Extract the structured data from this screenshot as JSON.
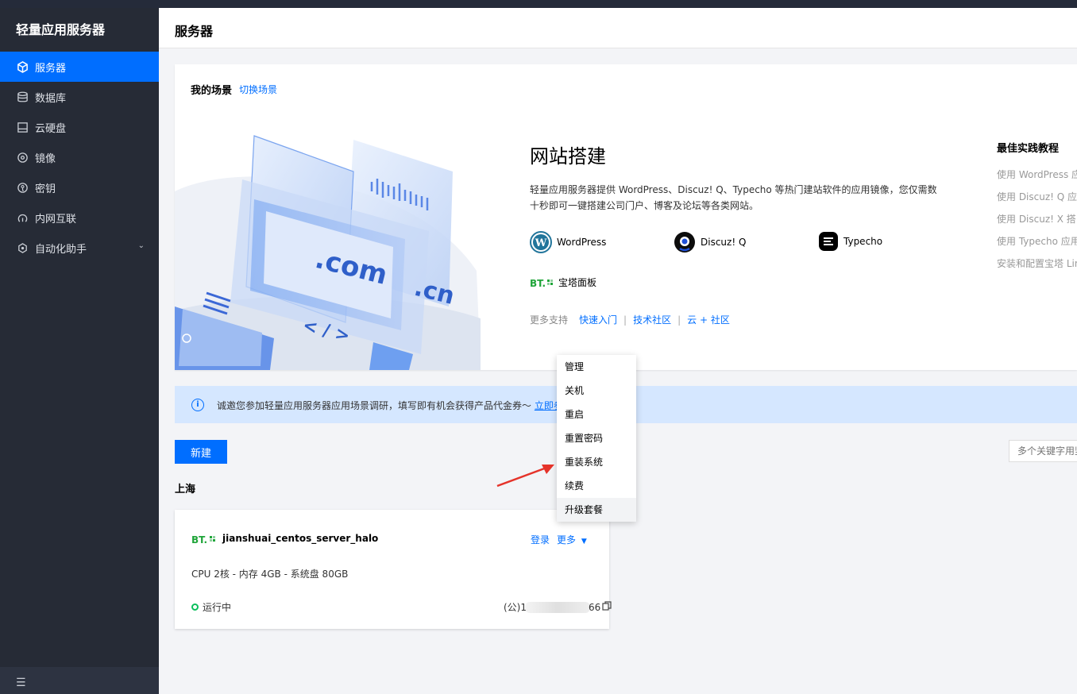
{
  "app": {
    "title": "轻量应用服务器"
  },
  "sidebar": {
    "items": [
      {
        "label": "服务器",
        "icon": "cube-icon"
      },
      {
        "label": "数据库",
        "icon": "database-icon"
      },
      {
        "label": "云硬盘",
        "icon": "disk-icon"
      },
      {
        "label": "镜像",
        "icon": "image-icon"
      },
      {
        "label": "密钥",
        "icon": "key-icon"
      },
      {
        "label": "内网互联",
        "icon": "network-icon"
      },
      {
        "label": "自动化助手",
        "icon": "robot-icon"
      }
    ]
  },
  "header": {
    "title": "服务器"
  },
  "scene": {
    "title": "我的场景",
    "switch": "切换场景",
    "heading": "网站搭建",
    "description": "轻量应用服务器提供 WordPress、Discuz! Q、Typecho 等热门建站软件的应用镜像，您仅需数十秒即可一键搭建公司门户、博客及论坛等各类网站。",
    "illustration": {
      "com": ".com",
      "cn": ".cn",
      "code": "< / >"
    },
    "apps": [
      {
        "label": "WordPress",
        "icon": "wordpress-icon"
      },
      {
        "label": "Discuz! Q",
        "icon": "discuz-icon"
      },
      {
        "label": "Typecho",
        "icon": "typecho-icon"
      },
      {
        "label": "宝塔面板",
        "icon": "bt-panel-icon"
      }
    ],
    "more": {
      "label": "更多支持",
      "links": [
        "快速入门",
        "技术社区",
        "云 + 社区"
      ]
    },
    "best": {
      "title": "最佳实践教程",
      "items": [
        "使用 WordPress 应",
        "使用 Discuz! Q 应用",
        "使用 Discuz! X 搭",
        "使用 Typecho 应用",
        "安装和配置宝塔 Lin"
      ]
    }
  },
  "notice": {
    "text": "诚邀您参加轻量应用服务器应用场景调研，填写即有机会获得产品代金券～",
    "link": "立即参"
  },
  "toolbar": {
    "new_label": "新建",
    "search_placeholder": "多个关键字用竖"
  },
  "region": "上海",
  "instance": {
    "badge": "BT.",
    "name": "jianshuai_centos_server_halo",
    "login": "登录",
    "more": "更多",
    "spec": "CPU 2核 - 内存 4GB - 系统盘 80GB",
    "status": "运行中",
    "ip_prefix": "(公)1",
    "ip_suffix": "66"
  },
  "dropdown": {
    "items": [
      "管理",
      "关机",
      "重启",
      "重置密码",
      "重装系统",
      "续费",
      "升级套餐"
    ]
  },
  "colors": {
    "accent": "#006eff",
    "sidebar": "#262b36",
    "running": "#0abf5b",
    "arrow": "#e5332a"
  }
}
